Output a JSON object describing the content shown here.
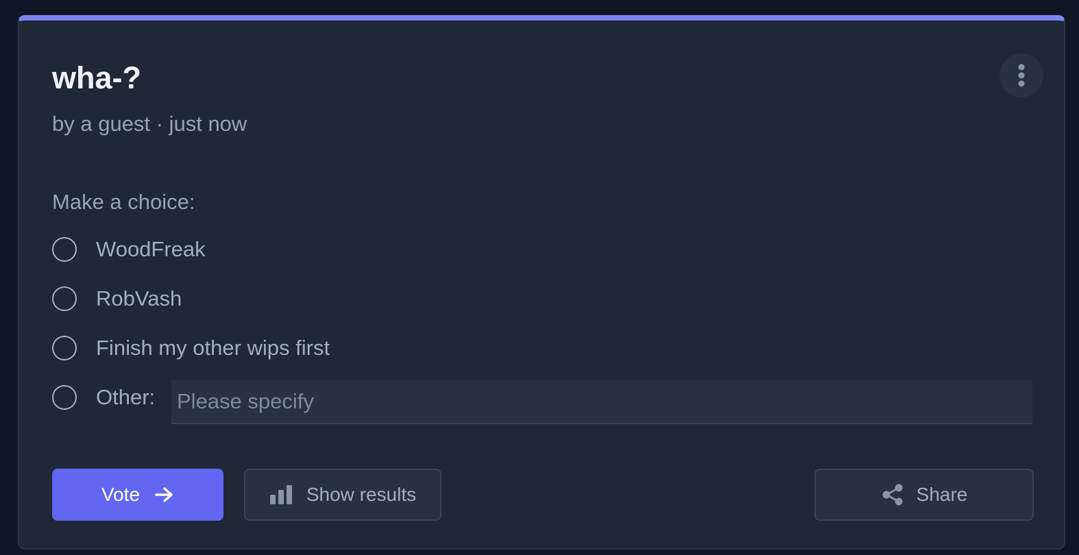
{
  "poll": {
    "title": "wha-?",
    "meta": "by a guest · just now",
    "prompt": "Make a choice:",
    "options": [
      {
        "label": "WoodFreak"
      },
      {
        "label": "RobVash"
      },
      {
        "label": "Finish my other wips first"
      },
      {
        "label": "Other:"
      }
    ],
    "other_placeholder": "Please specify"
  },
  "actions": {
    "vote_label": "Vote",
    "results_label": "Show results",
    "share_label": "Share"
  },
  "icons": {
    "menu": "more-vertical-icon",
    "vote": "arrow-right-icon",
    "results": "bar-chart-icon",
    "share": "share-icon"
  },
  "colors": {
    "accent": "#6366f1",
    "top_border": "#7c83f0",
    "card_bg": "#1e2837",
    "page_bg": "#0f1626"
  }
}
